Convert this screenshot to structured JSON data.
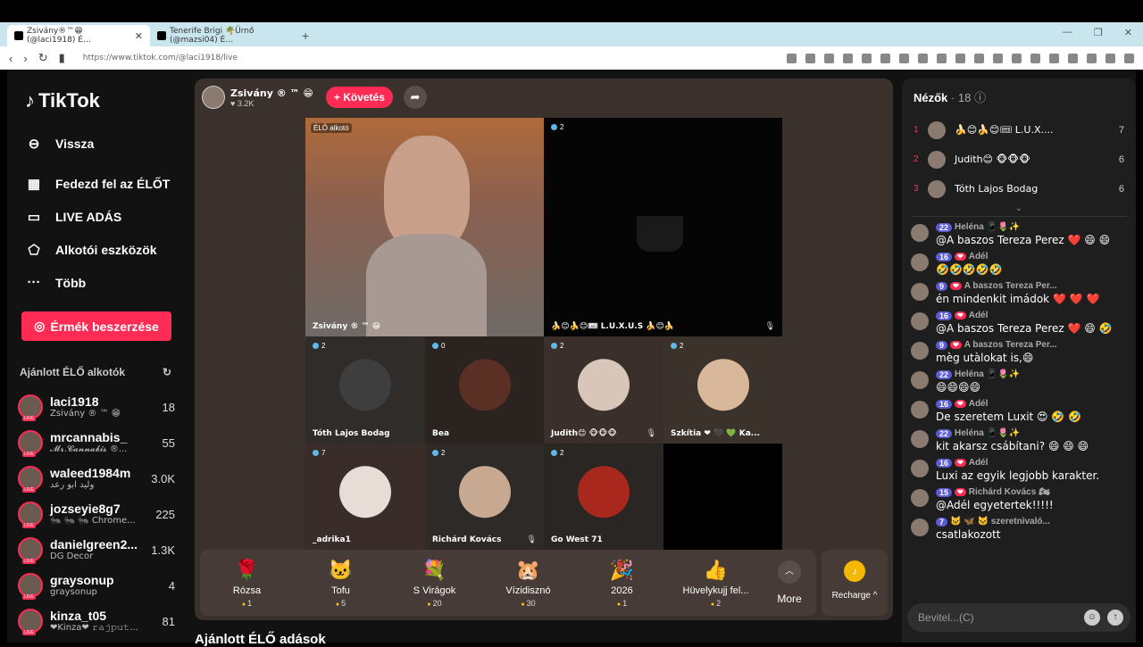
{
  "browser": {
    "tabs": [
      {
        "label": "Zsivány®™😁 (@laci1918) É…"
      },
      {
        "label": "Tenerife Brigi 🌴Ürnő (@mazsi04) É…"
      }
    ],
    "new_tab": "+",
    "url": "https://www.tiktok.com/@laci1918/live"
  },
  "sidebar": {
    "brand": "TikTok",
    "nav": [
      {
        "label": "Vissza",
        "icon": "back-arrow-icon"
      },
      {
        "label": "Fedezd fel az ÉLŐT",
        "icon": "calendar-icon"
      },
      {
        "label": "LIVE ADÁS",
        "icon": "video-camera-icon"
      },
      {
        "label": "Alkotói eszközök",
        "icon": "creator-tools-icon"
      },
      {
        "label": "Több",
        "icon": "more-dots-icon"
      }
    ],
    "coins_button": "Érmék beszerzése",
    "recommended_title": "Ajánlott ÉLŐ alkotók",
    "creators": [
      {
        "name": "laci1918",
        "sub": "Zsivány ® ™ 😁",
        "count": "18"
      },
      {
        "name": "mrcannabis_",
        "sub": "𝓜𝓻.𝓒𝓪𝓷𝓷𝓪𝓫𝓲𝓼 ®...",
        "count": "55"
      },
      {
        "name": "waleed1984m",
        "sub": "وليد ابو رعد",
        "count": "3.0K"
      },
      {
        "name": "jozseyie8g7",
        "sub": "🐜 🐜 🐜 Chrome...",
        "count": "225"
      },
      {
        "name": "danielgreen2...",
        "sub": "DG Decor",
        "count": "1.3K"
      },
      {
        "name": "graysonup",
        "sub": "graysonup",
        "count": "4"
      },
      {
        "name": "kinza_t05",
        "sub": "❤Kinza❤ 𝚛𝚊𝚓𝚙𝚞𝚝...",
        "count": "81"
      }
    ]
  },
  "live": {
    "host_name": "Zsivány ® ™ 😁",
    "host_likes": "♥ 3.2K",
    "follow_label": "+ Követés",
    "cells": [
      {
        "label": "Zsivány ® ™ 😁",
        "count": "",
        "tag": "ÉLŐ alkotó"
      },
      {
        "label": "🍌😊🍌😊🎟 L.U.X.U.S 🍌😊🍌",
        "count": "2"
      },
      {
        "label": "Tóth Lajos Bodag",
        "count": "2"
      },
      {
        "label": "Bea",
        "count": "0"
      },
      {
        "label": "Judith😊 🐵🐵🐵",
        "count": "2"
      },
      {
        "label": "Szkítia ❤ 🖤 💚 Ka...",
        "count": "2"
      },
      {
        "label": "_adrika1",
        "count": "7"
      },
      {
        "label": "Richárd Kovács",
        "count": "2"
      },
      {
        "label": "Go West 71",
        "count": "2"
      }
    ],
    "gifts": [
      {
        "name": "Rózsa",
        "price": "1",
        "icon": "🌹"
      },
      {
        "name": "Tofu",
        "price": "5",
        "icon": "🐱"
      },
      {
        "name": "S Virágok",
        "price": "20",
        "icon": "💐"
      },
      {
        "name": "Vízidisznó",
        "price": "30",
        "icon": "🐹"
      },
      {
        "name": "2026",
        "price": "1",
        "icon": "🎉"
      },
      {
        "name": "Hüvelykujj fel...",
        "price": "2",
        "icon": "👍"
      }
    ],
    "more_label": "More",
    "recharge_label": "Recharge ^",
    "below_title": "Ajánlott ÉLŐ adások"
  },
  "viewers": {
    "title": "Nézők",
    "count": "· 18",
    "top": [
      {
        "rank": "1",
        "name": "🍌😊🍌😊🎟 L.U.X....",
        "score": "7"
      },
      {
        "rank": "2",
        "name": "Judith😊 🐵🐵🐵",
        "score": "6"
      },
      {
        "rank": "3",
        "name": "Tóth Lajos Bodag",
        "score": "6"
      }
    ]
  },
  "chat": [
    {
      "level": "22",
      "fan": "",
      "user": "Heléna 📱🌷✨",
      "text": "@A baszos Tereza Perez ❤️ 😄 😄"
    },
    {
      "level": "16",
      "fan": "❤",
      "user": "Adél",
      "text": "🤣🤣🤣🤣🤣"
    },
    {
      "level": "9",
      "fan": "❤",
      "user": "A baszos Tereza Per...",
      "text": "én mindenkit imádok ❤️ ❤️ ❤️"
    },
    {
      "level": "16",
      "fan": "❤",
      "user": "Adél",
      "text": "@A baszos Tereza Perez ❤️ 😄 🤣"
    },
    {
      "level": "9",
      "fan": "❤",
      "user": "A baszos Tereza Per...",
      "text": "mèg utàlokat is,😄"
    },
    {
      "level": "22",
      "fan": "",
      "user": "Heléna 📱🌷✨",
      "text": "😄😄😄😄"
    },
    {
      "level": "16",
      "fan": "❤",
      "user": "Adél",
      "text": "De szeretem Luxit 😍 🤣 🤣"
    },
    {
      "level": "22",
      "fan": "",
      "user": "Heléna 📱🌷✨",
      "text": "kit akarsz csábítani? 😄 😄 😄"
    },
    {
      "level": "16",
      "fan": "❤",
      "user": "Adél",
      "text": "Luxi az egyik legjobb karakter."
    },
    {
      "level": "15",
      "fan": "❤",
      "user": "Richárd Kovács 🏍",
      "text": "@Adél egyetertek!!!!!"
    },
    {
      "level": "7",
      "fan": "",
      "user": "🐱 🦋 🐱 szeretnìvaló...",
      "text": "csatlakozott"
    }
  ],
  "input_placeholder": "Bevitel...(C)"
}
